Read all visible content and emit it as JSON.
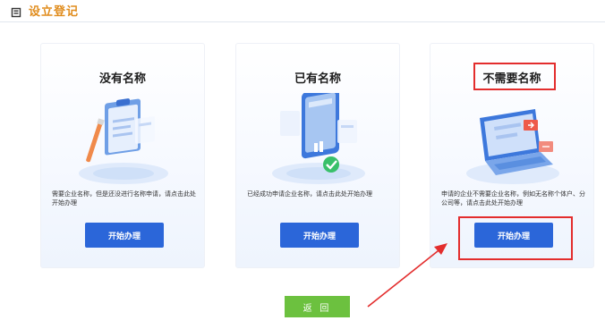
{
  "header": {
    "title": "设立登记"
  },
  "cards": [
    {
      "title": "没有名称",
      "description": "需要企业名称，但是还没进行名称申请，请点击此处开始办理",
      "button": "开始办理"
    },
    {
      "title": "已有名称",
      "description": "已经成功申请企业名称，请点击此处开始办理",
      "button": "开始办理"
    },
    {
      "title": "不需要名称",
      "description": "申请的企业不需要企业名称，例如无名称个体户、分公司等，请点击此处开始办理",
      "button": "开始办理"
    }
  ],
  "back_button": "返 回",
  "colors": {
    "header_title": "#e08c1c",
    "primary_button": "#2b66d9",
    "back_button": "#6cc13f",
    "annotation": "#e32d2d"
  }
}
